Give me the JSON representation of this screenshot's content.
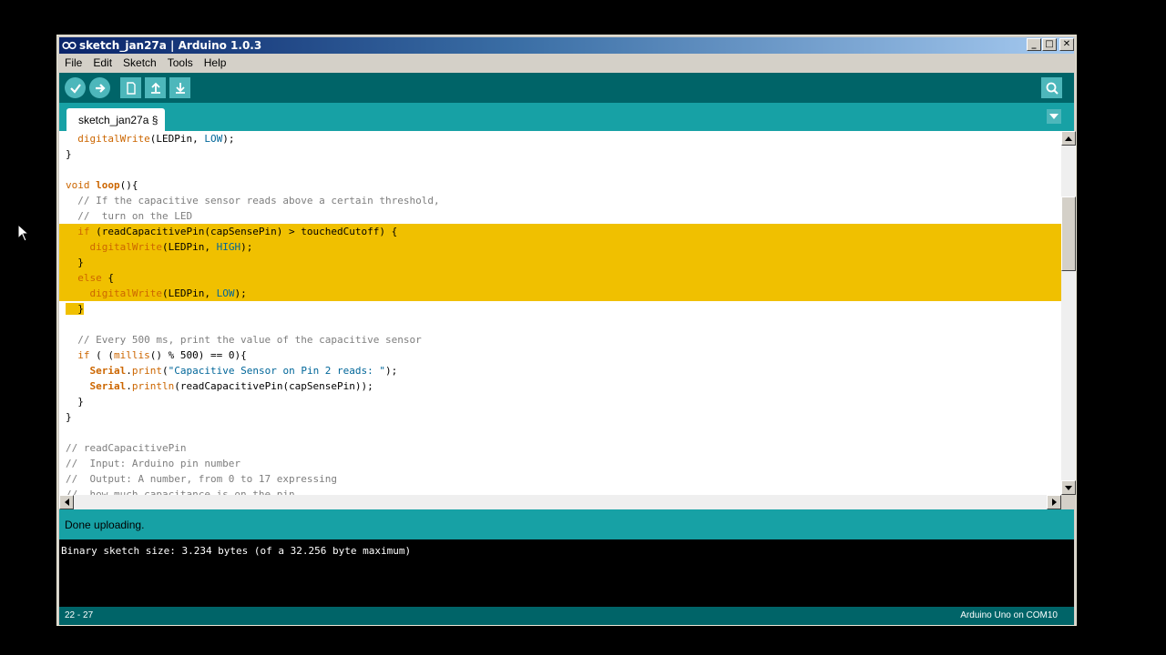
{
  "window": {
    "title": "sketch_jan27a | Arduino 1.0.3",
    "controls": {
      "minimize": "_",
      "maximize": "□",
      "close": "✕"
    }
  },
  "menu": [
    "File",
    "Edit",
    "Sketch",
    "Tools",
    "Help"
  ],
  "toolbar": {
    "buttons": [
      "verify-icon",
      "upload-icon",
      "new-icon",
      "open-icon",
      "save-icon"
    ],
    "serial_monitor": "serial-monitor-icon"
  },
  "tab": {
    "label": "sketch_jan27a §"
  },
  "status": {
    "message": "Done uploading."
  },
  "console": {
    "text": "Binary sketch size: 3.234 bytes (of a 32.256 byte maximum)"
  },
  "footer": {
    "line_range": "22 - 27",
    "board": "Arduino Uno on COM10"
  },
  "colors": {
    "toolbar": "#006468",
    "tabbar": "#17a1a5",
    "highlight": "#f0c000"
  }
}
